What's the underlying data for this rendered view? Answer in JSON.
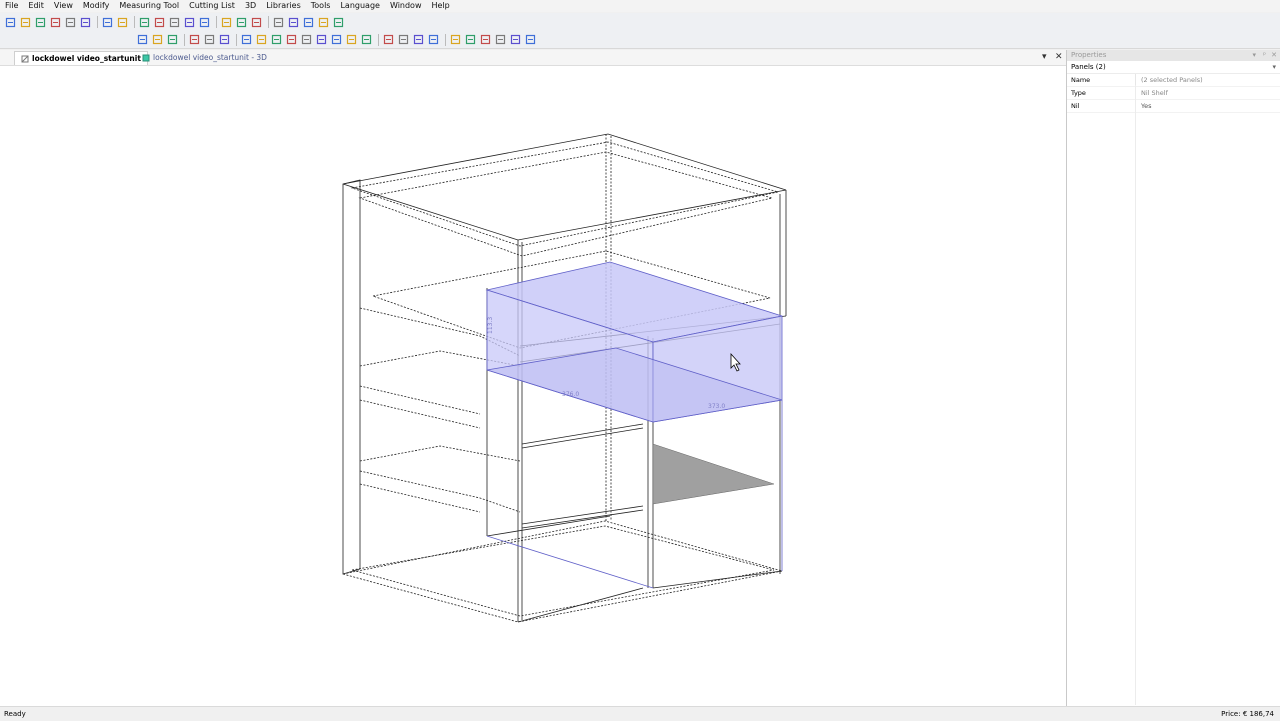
{
  "menu": [
    "File",
    "Edit",
    "View",
    "Modify",
    "Measuring Tool",
    "Cutting List",
    "3D",
    "Libraries",
    "Tools",
    "Language",
    "Window",
    "Help"
  ],
  "tabs": {
    "active": "lockdowel video_startunit",
    "inactive": "lockdowel video_startunit - 3D"
  },
  "properties": {
    "title": "Properties",
    "selector": "Panels (2)",
    "rows": [
      {
        "key": "Name",
        "value": "(2 selected Panels)"
      },
      {
        "key": "Type",
        "value": "Nil Shelf"
      },
      {
        "key": "Nil",
        "value": "Yes"
      }
    ]
  },
  "viewport_labels": {
    "dim1": "113.3",
    "dim2": "376.0",
    "dim3": "373.0"
  },
  "status": {
    "left": "Ready",
    "right": "Price: € 186,74"
  },
  "colors": {
    "selection_fill": "#c8c8f8",
    "selection_stroke": "#6060c8",
    "accent": "#3f6fd8",
    "shadow_panel": "#a0a0a0"
  },
  "icons": {
    "toolbar1": [
      "new-icon",
      "new-from-template-icon",
      "open-icon",
      "save-icon",
      "print-icon",
      "print-preview-icon",
      "undo-icon",
      "redo-icon",
      "select-icon",
      "wireframe-icon",
      "solid-icon",
      "view-icon",
      "render-icon",
      "measure-icon",
      "pencil-icon",
      "info-icon",
      "zoom-in-icon",
      "zoom-out-icon",
      "zoom-window-icon",
      "zoom-all-icon",
      "pan-icon"
    ],
    "toolbar2": [
      "vertical-dimension-icon",
      "horizontal-dimension-icon",
      "aligned-dimension-icon",
      "check-icon",
      "stop-icon",
      "play-icon",
      "align-icon",
      "distribute-icon",
      "frame-icon",
      "panel-icon",
      "shelf-icon",
      "divider-icon",
      "drawer-icon",
      "door-icon",
      "back-icon",
      "cut-icon",
      "hinge-icon",
      "handle-icon",
      "leg-icon",
      "rail-icon",
      "shape-icon",
      "connector-icon",
      "tool-icon",
      "close-icon",
      "settings-icon"
    ]
  }
}
